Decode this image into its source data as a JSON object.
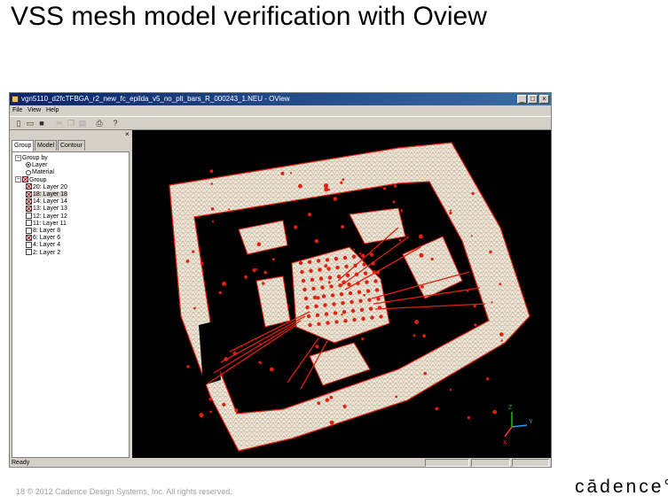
{
  "slide": {
    "title": "VSS mesh model verification with Oview",
    "footer": "18      © 2012 Cadence Design Systems, Inc. All rights reserved.",
    "logo": "cādence°"
  },
  "window": {
    "title": "vgn5110_d2fcTFBGA_r2_new_fc_epilda_v5_no_plt_bars_R_000243_1.NEU - OView",
    "buttons": {
      "minimize": "_",
      "maximize": "□",
      "close": "×"
    }
  },
  "menu": [
    "File",
    "View",
    "Help"
  ],
  "toolbar": [
    "new-icon",
    "open-icon",
    "save-icon",
    "cut-icon",
    "copy-icon",
    "paste-icon",
    "print-icon",
    "help-icon"
  ],
  "panel": {
    "close": "×",
    "tabs": [
      "Group",
      "Model",
      "Contour"
    ],
    "tree": [
      {
        "type": "expand",
        "label": "Group by",
        "indent": 0
      },
      {
        "type": "radio",
        "label": "Layer",
        "checked": true,
        "indent": 1
      },
      {
        "type": "radio",
        "label": "Material",
        "checked": false,
        "indent": 1
      },
      {
        "type": "expand-check",
        "label": "Group",
        "checked": true,
        "indent": 0
      },
      {
        "type": "check",
        "label": "20: Layer 20",
        "checked": true,
        "indent": 1
      },
      {
        "type": "check",
        "label": "18: Layer 18",
        "checked": true,
        "indent": 1,
        "selected": true
      },
      {
        "type": "check",
        "label": "14: Layer 14",
        "checked": true,
        "indent": 1
      },
      {
        "type": "check",
        "label": "13: Layer 13",
        "checked": true,
        "indent": 1
      },
      {
        "type": "check",
        "label": "12: Layer 12",
        "checked": false,
        "indent": 1
      },
      {
        "type": "check",
        "label": "11: Layer 11",
        "checked": false,
        "indent": 1
      },
      {
        "type": "check",
        "label": "8: Layer 8",
        "checked": false,
        "indent": 1
      },
      {
        "type": "check",
        "label": "6: Layer 6",
        "checked": true,
        "indent": 1
      },
      {
        "type": "check",
        "label": "4: Layer 4",
        "checked": false,
        "indent": 1
      },
      {
        "type": "check",
        "label": "2: Layer 2",
        "checked": false,
        "indent": 1
      }
    ]
  },
  "axes": {
    "z": "Z",
    "y": "Y",
    "x": "X"
  },
  "status": "Ready",
  "colors": {
    "mesh": "#efe6d6",
    "nodes": "#e02010",
    "viewport": "#000000",
    "titlebar": "#0a246a"
  }
}
